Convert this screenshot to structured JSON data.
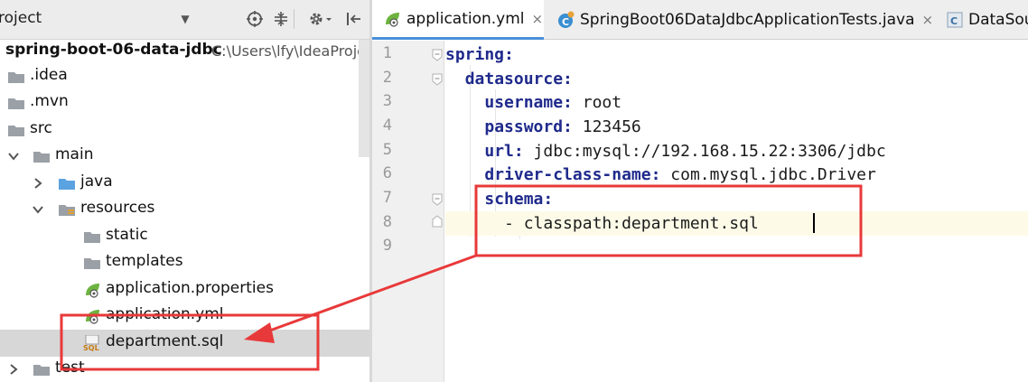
{
  "project_panel": {
    "title": "roject",
    "dropdown_glyph": "▼",
    "toolbar_icons": [
      "crosshair-icon",
      "collapse-icon",
      "gear-icon",
      "hide-icon"
    ]
  },
  "tree": {
    "root_label": "spring-boot-06-data-jdbc",
    "root_path": "C:\\Users\\lfy\\IdeaProje",
    "items": [
      {
        "label": ".idea"
      },
      {
        "label": ".mvn"
      },
      {
        "label": "src"
      },
      {
        "label": "main"
      },
      {
        "label": "java"
      },
      {
        "label": "resources"
      },
      {
        "label": "static"
      },
      {
        "label": "templates"
      },
      {
        "label": "application.properties"
      },
      {
        "label": "application.yml"
      },
      {
        "label": "department.sql"
      },
      {
        "label": "test"
      }
    ]
  },
  "tabs": [
    {
      "label": "application.yml",
      "close": "×"
    },
    {
      "label": "SpringBoot06DataJdbcApplicationTests.java",
      "close": "×"
    },
    {
      "label": "DataSou"
    }
  ],
  "editor": {
    "line_numbers": [
      "1",
      "2",
      "3",
      "4",
      "5",
      "6",
      "7",
      "8",
      "9"
    ],
    "lines": [
      {
        "indent": "",
        "key": "spring:",
        "value": ""
      },
      {
        "indent": "  ",
        "key": "datasource:",
        "value": ""
      },
      {
        "indent": "    ",
        "key": "username:",
        "value": " root"
      },
      {
        "indent": "    ",
        "key": "password:",
        "value": " 123456"
      },
      {
        "indent": "    ",
        "key": "url:",
        "value": " jdbc:mysql://192.168.15.22:3306/jdbc"
      },
      {
        "indent": "    ",
        "key": "driver-class-name:",
        "value": " com.mysql.jdbc.Driver"
      },
      {
        "indent": "    ",
        "key": "schema:",
        "value": ""
      },
      {
        "indent": "      ",
        "key": "",
        "value": "- classpath:department.sql"
      },
      {
        "indent": "",
        "key": "",
        "value": ""
      }
    ],
    "current_line": 8
  },
  "colors": {
    "annotation_red": "#e8393a",
    "key_blue": "#1f2a8c",
    "tab_active_underline": "#4a8fd9"
  }
}
